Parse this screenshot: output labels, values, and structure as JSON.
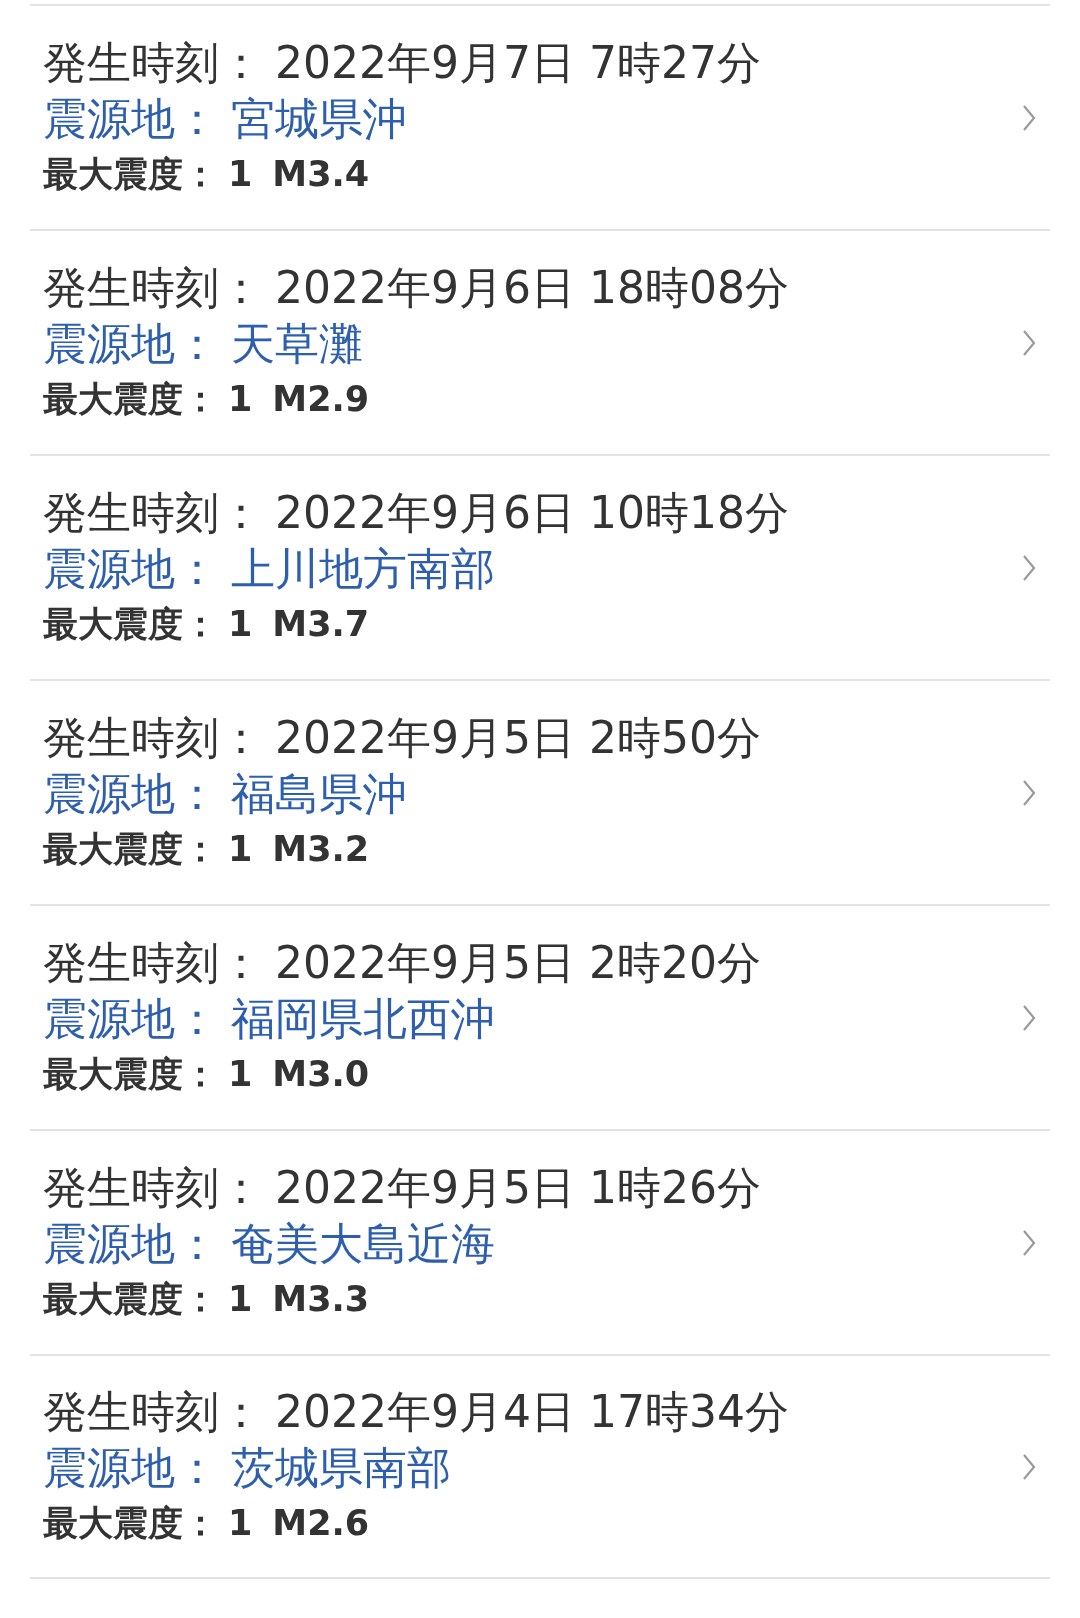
{
  "quakes": [
    {
      "time_label": "発生時刻：",
      "time": "2022年9月7日 7時27分",
      "epicenter_label": "震源地：",
      "epicenter": "宮城県沖",
      "intensity_label": "最大震度：",
      "intensity": "1",
      "magnitude": "M3.4"
    },
    {
      "time_label": "発生時刻：",
      "time": "2022年9月6日 18時08分",
      "epicenter_label": "震源地：",
      "epicenter": "天草灘",
      "intensity_label": "最大震度：",
      "intensity": "1",
      "magnitude": "M2.9"
    },
    {
      "time_label": "発生時刻：",
      "time": "2022年9月6日 10時18分",
      "epicenter_label": "震源地：",
      "epicenter": "上川地方南部",
      "intensity_label": "最大震度：",
      "intensity": "1",
      "magnitude": "M3.7"
    },
    {
      "time_label": "発生時刻：",
      "time": "2022年9月5日 2時50分",
      "epicenter_label": "震源地：",
      "epicenter": "福島県沖",
      "intensity_label": "最大震度：",
      "intensity": "1",
      "magnitude": "M3.2"
    },
    {
      "time_label": "発生時刻：",
      "time": "2022年9月5日 2時20分",
      "epicenter_label": "震源地：",
      "epicenter": "福岡県北西沖",
      "intensity_label": "最大震度：",
      "intensity": "1",
      "magnitude": "M3.0"
    },
    {
      "time_label": "発生時刻：",
      "time": "2022年9月5日 1時26分",
      "epicenter_label": "震源地：",
      "epicenter": "奄美大島近海",
      "intensity_label": "最大震度：",
      "intensity": "1",
      "magnitude": "M3.3"
    },
    {
      "time_label": "発生時刻：",
      "time": "2022年9月4日 17時34分",
      "epicenter_label": "震源地：",
      "epicenter": "茨城県南部",
      "intensity_label": "最大震度：",
      "intensity": "1",
      "magnitude": "M2.6"
    }
  ]
}
